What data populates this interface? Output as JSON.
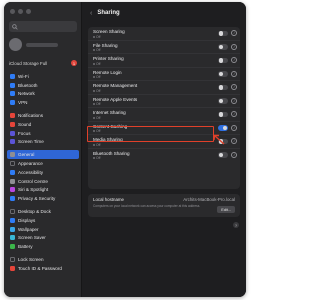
{
  "window": {
    "title": "Sharing"
  },
  "sidebar": {
    "account": {
      "storage_label": "iCloud Storage Full",
      "badge": "1"
    },
    "items": [
      {
        "label": "Wi-Fi",
        "icon": "wifi-icon",
        "color": "#2f7cf6",
        "gap": false
      },
      {
        "label": "Bluetooth",
        "icon": "bluetooth-icon",
        "color": "#2f7cf6",
        "gap": false
      },
      {
        "label": "Network",
        "icon": "globe-icon",
        "color": "#2f7cf6",
        "gap": false
      },
      {
        "label": "VPN",
        "icon": "vpn-icon",
        "color": "#2f7cf6",
        "gap": false
      },
      {
        "label": "Notifications",
        "icon": "bell-icon",
        "color": "#e5453a",
        "gap": true
      },
      {
        "label": "Sound",
        "icon": "speaker-icon",
        "color": "#e5453a",
        "gap": false
      },
      {
        "label": "Focus",
        "icon": "moon-icon",
        "color": "#5b54d6",
        "gap": false
      },
      {
        "label": "Screen Time",
        "icon": "hourglass-icon",
        "color": "#5b54d6",
        "gap": false
      },
      {
        "label": "General",
        "icon": "gear-icon",
        "color": "#8e8e93",
        "gap": true,
        "active": true
      },
      {
        "label": "Appearance",
        "icon": "appearance-icon",
        "color": "#2a2a2c",
        "gap": false
      },
      {
        "label": "Accessibility",
        "icon": "accessibility-icon",
        "color": "#2f7cf6",
        "gap": false
      },
      {
        "label": "Control Centre",
        "icon": "control-centre-icon",
        "color": "#8e8e93",
        "gap": false
      },
      {
        "label": "Siri & Spotlight",
        "icon": "siri-icon",
        "color": "#b847e0",
        "gap": false
      },
      {
        "label": "Privacy & Security",
        "icon": "hand-icon",
        "color": "#2f7cf6",
        "gap": false
      },
      {
        "label": "Desktop & Dock",
        "icon": "dock-icon",
        "color": "#2a2a2c",
        "gap": true
      },
      {
        "label": "Displays",
        "icon": "display-icon",
        "color": "#2f7cf6",
        "gap": false
      },
      {
        "label": "Wallpaper",
        "icon": "wallpaper-icon",
        "color": "#39a7e8",
        "gap": false
      },
      {
        "label": "Screen Saver",
        "icon": "screensaver-icon",
        "color": "#39b8d6",
        "gap": false
      },
      {
        "label": "Battery",
        "icon": "battery-icon",
        "color": "#3bb54a",
        "gap": false
      },
      {
        "label": "Lock Screen",
        "icon": "lock-icon",
        "color": "#2a2a2c",
        "gap": true
      },
      {
        "label": "Touch ID & Password",
        "icon": "fingerprint-icon",
        "color": "#e5453a",
        "gap": false
      }
    ]
  },
  "services": [
    {
      "name": "Screen Sharing",
      "status": "Off",
      "on": false
    },
    {
      "name": "File Sharing",
      "status": "Off",
      "on": false
    },
    {
      "name": "Printer Sharing",
      "status": "Off",
      "on": false
    },
    {
      "name": "Remote Login",
      "status": "Off",
      "on": false
    },
    {
      "name": "Remote Management",
      "status": "Off",
      "on": false
    },
    {
      "name": "Remote Apple Events",
      "status": "Off",
      "on": false
    },
    {
      "name": "Internet Sharing",
      "status": "Off",
      "on": false,
      "highlighted": true
    },
    {
      "name": "Content Caching",
      "status": "Off",
      "on": true
    },
    {
      "name": "Media Sharing",
      "status": "Off",
      "on": false
    },
    {
      "name": "Bluetooth Sharing",
      "status": "Off",
      "on": false
    }
  ],
  "local_hostname": {
    "label": "Local hostname",
    "value": "Archits-MacBook-Pro.local",
    "description": "Computers on your local network can access your computer at this address.",
    "edit_label": "Edit..."
  },
  "help_label": "?",
  "colors": {
    "highlight": "#e0402a",
    "accent": "#2f66d6"
  }
}
